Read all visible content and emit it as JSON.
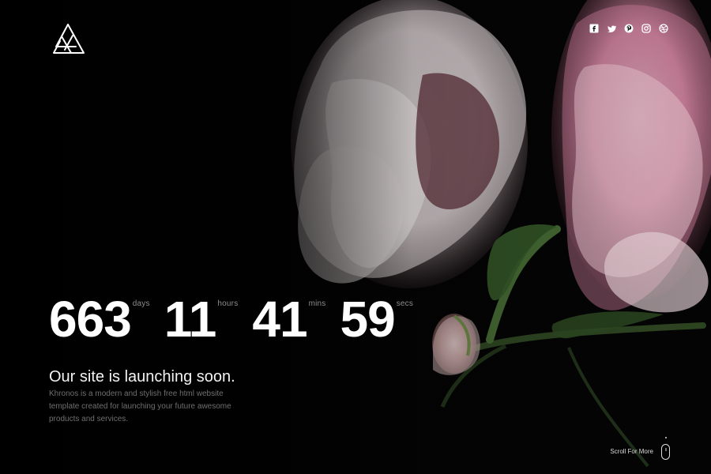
{
  "countdown": {
    "days_value": "663",
    "days_label": "days",
    "hours_value": "11",
    "hours_label": "hours",
    "mins_value": "41",
    "mins_label": "mins",
    "secs_value": "59",
    "secs_label": "secs"
  },
  "launch": {
    "title": "Our site is launching soon.",
    "description": "Khronos is a modern and stylish free html website template created for launching your future awesome products and services."
  },
  "scroll": {
    "label": "Scroll For More"
  },
  "icons": {
    "logo": "triangle-logo",
    "social": [
      "facebook-icon",
      "twitter-icon",
      "pinterest-icon",
      "instagram-icon",
      "dribbble-icon"
    ],
    "scroll": "mouse-icon"
  },
  "colors": {
    "background": "#050505",
    "primary_text": "#ffffff",
    "muted_text": "#6f6f6f",
    "label_text": "#8d8d8d"
  }
}
